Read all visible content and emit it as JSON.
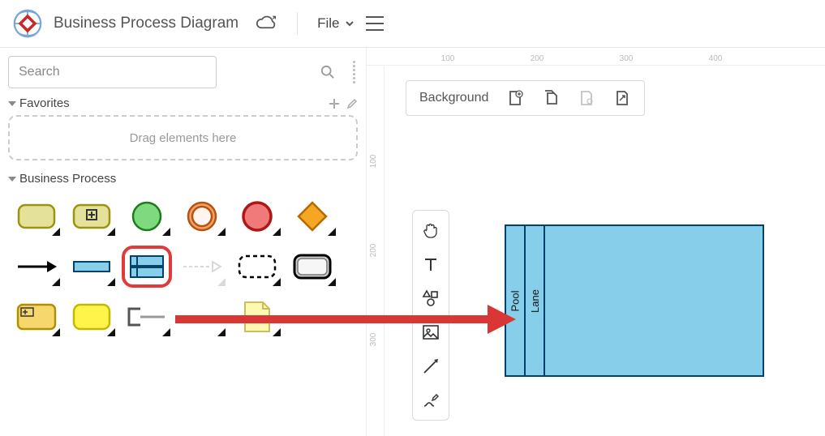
{
  "header": {
    "title": "Business Process Diagram",
    "file_menu": "File"
  },
  "sidebar": {
    "search_placeholder": "Search",
    "favorites": {
      "title": "Favorites",
      "dropzone": "Drag elements here"
    },
    "business_process": {
      "title": "Business Process"
    },
    "shapes": [
      {
        "name": "task-shape"
      },
      {
        "name": "subprocess-shape"
      },
      {
        "name": "start-event-shape"
      },
      {
        "name": "intermediate-event-shape"
      },
      {
        "name": "end-event-shape"
      },
      {
        "name": "gateway-shape"
      },
      {
        "name": "sequence-flow-shape"
      },
      {
        "name": "data-object-shape"
      },
      {
        "name": "pool-lane-shape"
      },
      {
        "name": "message-flow-shape"
      },
      {
        "name": "group-shape"
      },
      {
        "name": "call-activity-shape"
      },
      {
        "name": "expanded-subprocess-shape"
      },
      {
        "name": "yellow-task-shape"
      },
      {
        "name": "annotation-shape"
      },
      {
        "name": "association-shape"
      },
      {
        "name": "note-shape"
      }
    ]
  },
  "canvas": {
    "background_label": "Background",
    "ruler_marks": [
      "100",
      "200",
      "300",
      "400"
    ],
    "ruler_marks_v": [
      "100",
      "200",
      "300"
    ],
    "pool": {
      "title": "Pool"
    },
    "lane": {
      "title": "Lane"
    }
  },
  "floating_toolbar": {
    "items": [
      "pan-tool",
      "text-tool",
      "shape-tool",
      "image-tool",
      "line-tool",
      "freehand-tool"
    ]
  }
}
